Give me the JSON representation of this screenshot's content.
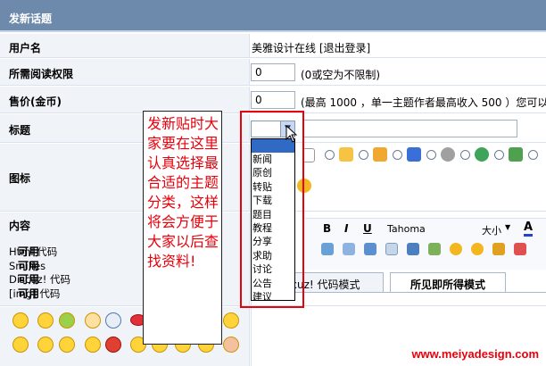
{
  "header": {
    "title": "发新话题"
  },
  "rows": {
    "username": {
      "label": "用户名",
      "value": "美雅设计在线 [退出登录]"
    },
    "read_permission": {
      "label": "所需阅读权限",
      "input_value": "0",
      "note": "(0或空为不限制)"
    },
    "price": {
      "label": "售价(金币)",
      "input_value": "0",
      "note": "(最高 1000 ，单一主题作者最高收入 500 ）您可以使"
    },
    "subject": {
      "label": "标题"
    },
    "icon": {
      "label": "图标"
    },
    "content": {
      "label": "内容",
      "codes": [
        {
          "name": "Html 代码",
          "status": "可用"
        },
        {
          "name": "Smilies",
          "status": "可用"
        },
        {
          "name": "Discuz! 代码",
          "status": "可用"
        },
        {
          "name": "[img] 代码",
          "status": "可用"
        }
      ]
    }
  },
  "annotation": {
    "lines": [
      "发新贴时大",
      "家要在这里",
      "认真选择最",
      "合适的主题",
      "分类，这样",
      "将会方便于",
      "大家以后查",
      "找资料!"
    ]
  },
  "dropdown": {
    "selected": "",
    "options": [
      "新闻",
      "原创",
      "转贴",
      "下载",
      "题目",
      "教程",
      "分享",
      "求助",
      "讨论",
      "公告",
      "建议"
    ]
  },
  "editor": {
    "font_name": "Tahoma",
    "font_size": "大小",
    "bold": "B",
    "italic": "I",
    "underline": "U",
    "tabs": {
      "code_mode": "cuz! 代码模式",
      "wysiwyg_mode": "所见即所得模式"
    }
  },
  "watermark": "www.meiyadesign.com",
  "colors": {
    "header_bg": "#6d8aad",
    "annotation_text": "#e8000b",
    "highlight": "#316ac5"
  }
}
